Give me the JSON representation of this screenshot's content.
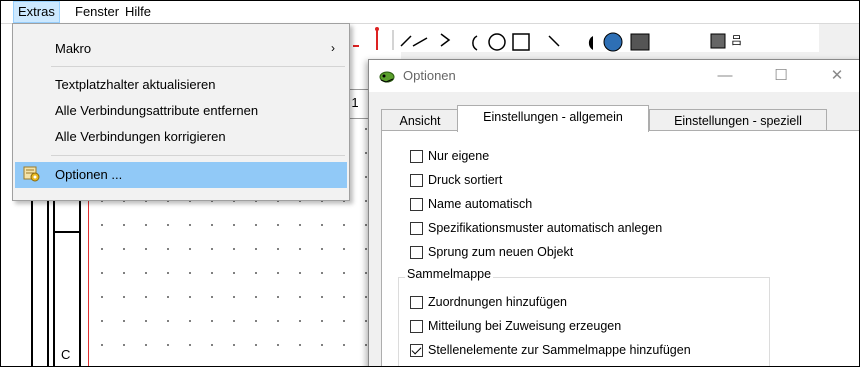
{
  "menubar": {
    "items": [
      "Extras",
      "Fenster",
      "Hilfe"
    ]
  },
  "dropdown": {
    "items": [
      {
        "label": "Makro",
        "submenu": "›"
      },
      {
        "label": "Textplatzhalter aktualisieren"
      },
      {
        "label": "Alle Verbindungsattribute entfernen"
      },
      {
        "label": "Alle Verbindungen korrigieren"
      },
      {
        "label": "Optionen ..."
      }
    ]
  },
  "background": {
    "tab_number": "1",
    "letter": "C"
  },
  "dialog": {
    "title": "Optionen",
    "minimize": "—",
    "maximize": "☐",
    "close": "✕",
    "tabs": [
      "Ansicht",
      "Einstellungen - allgemein",
      "Einstellungen - speziell"
    ],
    "selected_tab": 1,
    "checkboxes": [
      {
        "label": "Nur eigene",
        "checked": false
      },
      {
        "label": "Druck sortiert",
        "checked": false
      },
      {
        "label": "Name automatisch",
        "checked": false
      },
      {
        "label": "Spezifikationsmuster automatisch anlegen",
        "checked": false
      },
      {
        "label": "Sprung zum neuen Objekt",
        "checked": false
      }
    ],
    "group": {
      "label": "Sammelmappe",
      "checkboxes": [
        {
          "label": "Zuordnungen hinzufügen",
          "checked": false
        },
        {
          "label": "Mitteilung bei Zuweisung erzeugen",
          "checked": false
        },
        {
          "label": "Stellenelemente zur Sammelmappe hinzufügen",
          "checked": true
        }
      ]
    }
  },
  "colors": {
    "menu_highlight": "#91c9f7",
    "menubar_active": "#cce8ff",
    "red_line": "#e03030"
  }
}
